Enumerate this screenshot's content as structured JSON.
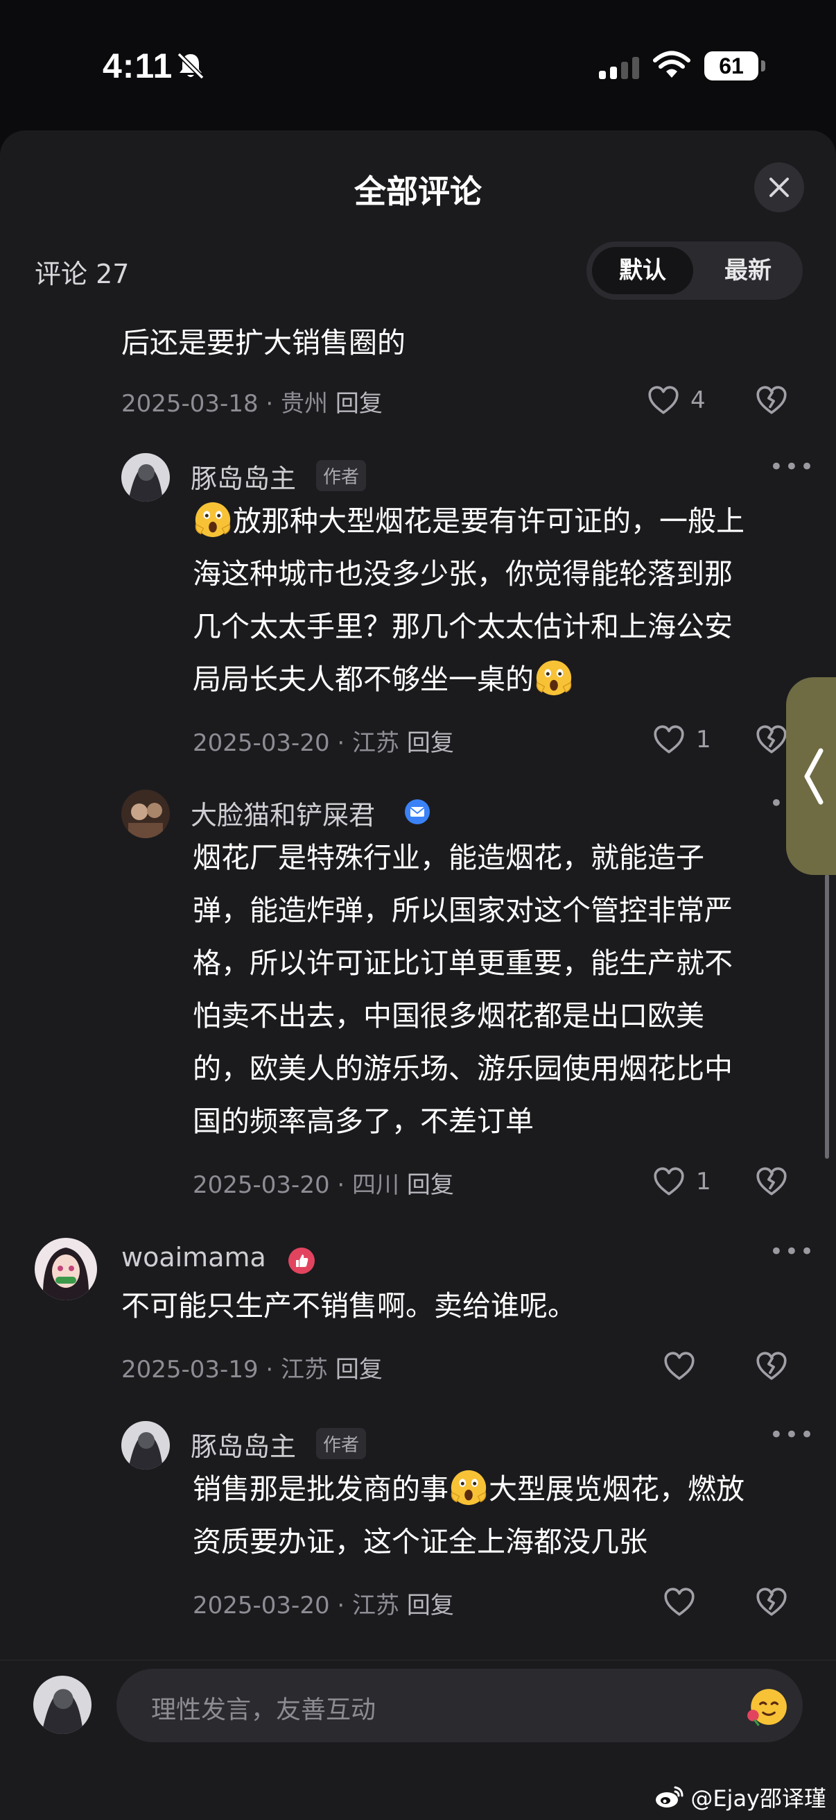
{
  "status_bar": {
    "time": "4:11",
    "battery": "61"
  },
  "sheet": {
    "title": "全部评论",
    "count_label": "评论 27",
    "sort": {
      "default": "默认",
      "newest": "最新"
    }
  },
  "comments": [
    {
      "body_line": "后还是要扩大销售圈的",
      "date": "2025-03-18",
      "location": "贵州",
      "reply": "回复",
      "likes": "4"
    },
    {
      "name": "豚岛岛主",
      "tag": "作者",
      "lines": [
        "放那种大型烟花是要有许可证的，一般上",
        "海这种城市也没多少张，你觉得能轮落到那",
        "几个太太手里？那几个太太估计和上海公安",
        "局局长夫人都不够坐一桌的"
      ],
      "date": "2025-03-20",
      "location": "江苏",
      "reply": "回复",
      "likes": "1"
    },
    {
      "name": "大脸猫和铲屎君",
      "lines": [
        "烟花厂是特殊行业，能造烟花，就能造子",
        "弹，能造炸弹，所以国家对这个管控非常严",
        "格，所以许可证比订单更重要，能生产就不",
        "怕卖不出去，中国很多烟花都是出口欧美",
        "的，欧美人的游乐场、游乐园使用烟花比中",
        "国的频率高多了，不差订单"
      ],
      "date": "2025-03-20",
      "location": "四川",
      "reply": "回复",
      "likes": "1"
    },
    {
      "name": "woaimama",
      "body": "不可能只生产不销售啊。卖给谁呢。",
      "date": "2025-03-19",
      "location": "江苏",
      "reply": "回复"
    },
    {
      "name": "豚岛岛主",
      "tag": "作者",
      "line1_a": "销售那是批发商的事",
      "line1_b": "大型展览烟花，燃放",
      "line2": "资质要办证，这个证全上海都没几张",
      "date": "2025-03-20",
      "location": "江苏",
      "reply": "回复"
    }
  ],
  "input": {
    "placeholder": "理性发言，友善互动"
  },
  "watermark": "@Ejay邵译瑾",
  "icons": {
    "close": "close-icon",
    "like": "heart-icon",
    "dislike": "broken-heart-icon",
    "more": "more-dots-icon",
    "emoji_shock": "shocked-face-emoji",
    "verified": "verified-badge-icon",
    "thumb": "thumb-badge-icon"
  }
}
